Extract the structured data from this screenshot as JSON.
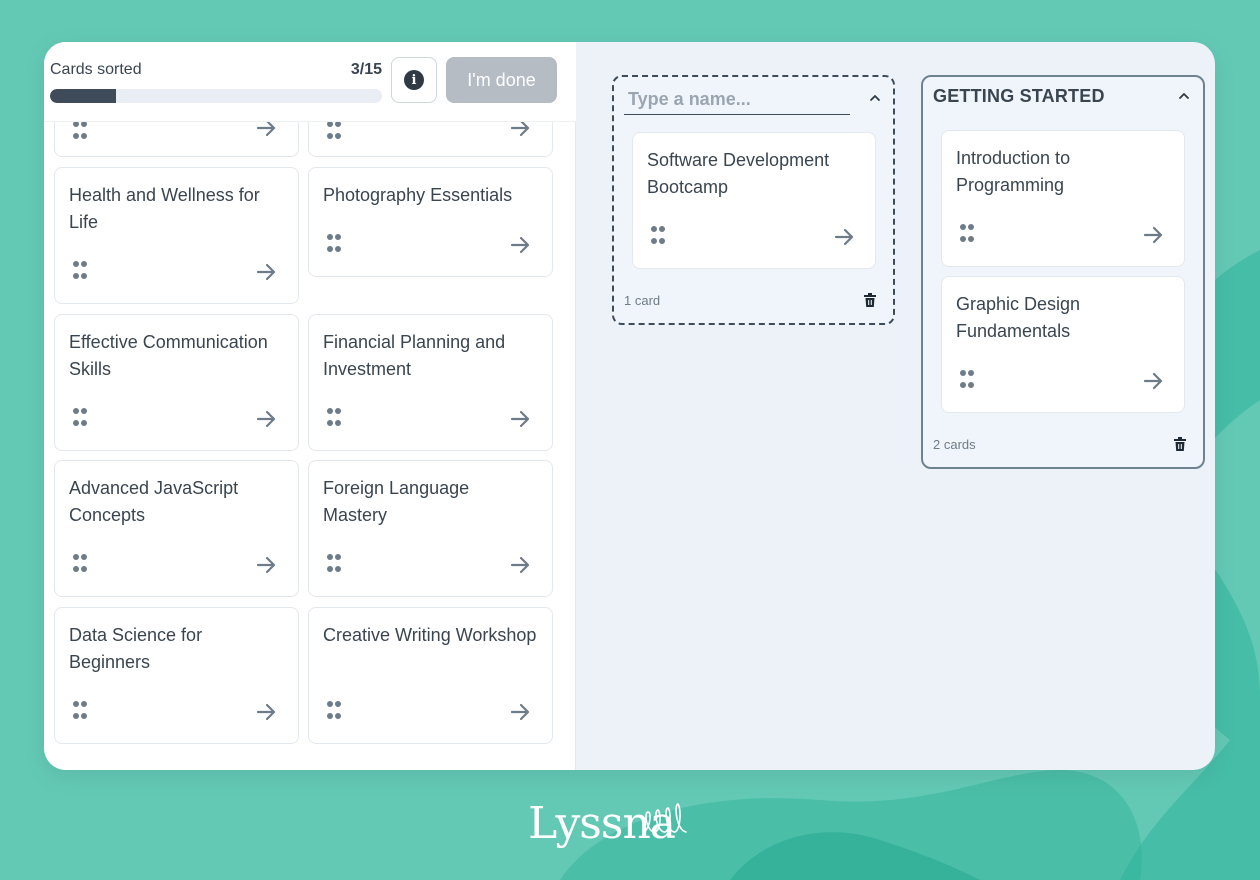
{
  "progress": {
    "label": "Cards sorted",
    "count_text": "3/15",
    "sorted": 3,
    "total": 15
  },
  "done_button": {
    "label": "I'm done"
  },
  "colors": {
    "background": "#63c9b5",
    "progress_fill": "#3e4c5a",
    "done_disabled": "#b5bcc4",
    "panel": "#edf2f8"
  },
  "icons": {
    "info": "info-icon",
    "drag": "drag-handle-icon",
    "move": "arrow-right-icon",
    "collapse": "chevron-up-icon",
    "delete": "trash-icon"
  },
  "unsorted_cards": [
    {
      "title": ""
    },
    {
      "title": ""
    },
    {
      "title": "Health and Wellness for Life"
    },
    {
      "title": "Photography Essentials"
    },
    {
      "title": "Effective Communication Skills"
    },
    {
      "title": "Financial Planning and Investment"
    },
    {
      "title": "Advanced JavaScript Concepts"
    },
    {
      "title": "Foreign Language Mastery"
    },
    {
      "title": "Data Science for Beginners"
    },
    {
      "title": "Creative Writing Workshop"
    }
  ],
  "groups": [
    {
      "name": "",
      "name_placeholder": "Type a name...",
      "cards": [
        {
          "title": "Software Development Bootcamp"
        }
      ],
      "count_text": "1 card"
    },
    {
      "name": "GETTING STARTED",
      "cards": [
        {
          "title": "Introduction to Programming"
        },
        {
          "title": "Graphic Design Fundamentals"
        }
      ],
      "count_text": "2 cards"
    }
  ],
  "brand": {
    "logo_text": "Lyssna"
  }
}
